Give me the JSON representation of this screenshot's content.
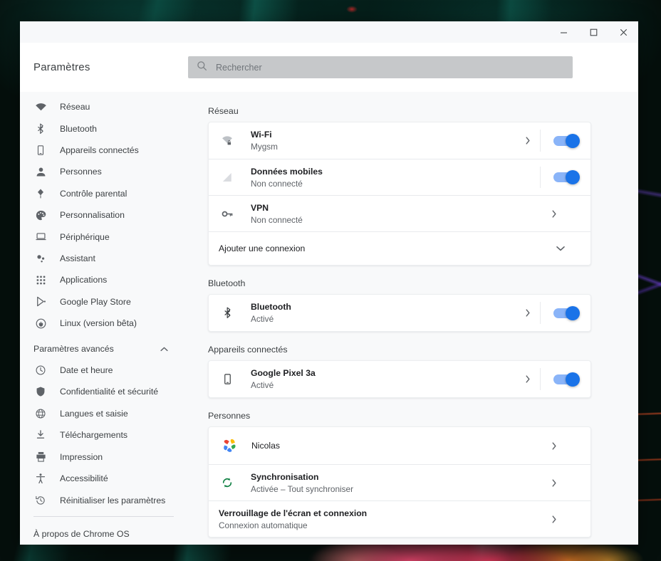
{
  "window": {
    "controls": {
      "minimize": "Réduire",
      "maximize": "Agrandir",
      "close": "Fermer"
    }
  },
  "header": {
    "title": "Paramètres",
    "search_placeholder": "Rechercher",
    "search_value": ""
  },
  "sidebar": {
    "items": [
      {
        "label": "Réseau",
        "icon": "wifi-icon"
      },
      {
        "label": "Bluetooth",
        "icon": "bluetooth-icon"
      },
      {
        "label": "Appareils connectés",
        "icon": "phone-icon"
      },
      {
        "label": "Personnes",
        "icon": "person-icon"
      },
      {
        "label": "Contrôle parental",
        "icon": "kite-icon"
      },
      {
        "label": "Personnalisation",
        "icon": "palette-icon"
      },
      {
        "label": "Périphérique",
        "icon": "laptop-icon"
      },
      {
        "label": "Assistant",
        "icon": "assistant-icon"
      },
      {
        "label": "Applications",
        "icon": "apps-grid-icon"
      },
      {
        "label": "Google Play Store",
        "icon": "play-store-icon"
      },
      {
        "label": "Linux (version bêta)",
        "icon": "linux-penguin-icon"
      }
    ],
    "advanced": {
      "label": "Paramètres avancés",
      "expanded": true,
      "items": [
        {
          "label": "Date et heure",
          "icon": "clock-icon"
        },
        {
          "label": "Confidentialité et sécurité",
          "icon": "shield-icon"
        },
        {
          "label": "Langues et saisie",
          "icon": "globe-icon"
        },
        {
          "label": "Téléchargements",
          "icon": "download-icon"
        },
        {
          "label": "Impression",
          "icon": "printer-icon"
        },
        {
          "label": "Accessibilité",
          "icon": "accessibility-icon"
        },
        {
          "label": "Réinitialiser les paramètres",
          "icon": "restore-icon"
        }
      ]
    },
    "about": {
      "label": "À propos de Chrome OS"
    }
  },
  "main": {
    "sections": [
      {
        "title": "Réseau",
        "rows": [
          {
            "title": "Wi-Fi",
            "sub": "Mygsm",
            "icon": "wifi-lock-icon",
            "arrow": true,
            "toggle": true,
            "separator": true
          },
          {
            "title": "Données mobiles",
            "sub": "Non connecté",
            "icon": "cellular-icon",
            "arrow": false,
            "toggle": true,
            "separator": true
          },
          {
            "title": "VPN",
            "sub": "Non connecté",
            "icon": "key-icon",
            "arrow": true,
            "toggle": false,
            "separator": false
          }
        ],
        "expand_row": {
          "label": "Ajouter une connexion",
          "icon": "chevron-down-icon"
        }
      },
      {
        "title": "Bluetooth",
        "rows": [
          {
            "title": "Bluetooth",
            "sub": "Activé",
            "icon": "bluetooth-icon",
            "arrow": true,
            "toggle": true,
            "separator": true
          }
        ]
      },
      {
        "title": "Appareils connectés",
        "rows": [
          {
            "title": "Google Pixel 3a",
            "sub": "Activé",
            "icon": "phone-icon",
            "arrow": true,
            "toggle": true,
            "separator": true
          }
        ]
      },
      {
        "title": "Personnes",
        "rows": [
          {
            "title": "Nicolas",
            "sub": "",
            "icon": "google-avatar-icon",
            "arrow": true,
            "toggle": false,
            "separator": false
          },
          {
            "title": "Synchronisation",
            "sub": "Activée – Tout synchroniser",
            "icon": "sync-icon",
            "arrow": true,
            "toggle": false,
            "separator": false
          },
          {
            "title": "Verrouillage de l'écran et connexion",
            "sub": "Connexion automatique",
            "icon": "none",
            "arrow": true,
            "toggle": false,
            "separator": false
          }
        ]
      }
    ]
  },
  "colors": {
    "accent": "#1a73e8",
    "accent_track": "#8ab4f8",
    "page_bg": "#f8f9fa",
    "card_bg": "#ffffff",
    "text_primary": "#202124",
    "text_secondary": "#5f6368",
    "sync_green": "#0f8043"
  }
}
